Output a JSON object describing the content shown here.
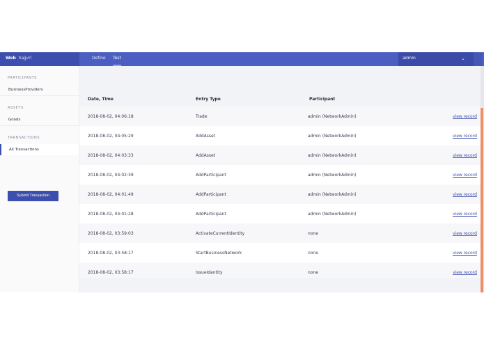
{
  "header": {
    "brand_strong": "Web",
    "brand_sub": "hajjvrl",
    "tabs": [
      {
        "label": "Define"
      },
      {
        "label": "Test"
      }
    ],
    "identity": "admin"
  },
  "sidebar": {
    "sections": [
      {
        "title": "PARTICIPANTS",
        "items": [
          "BusinessProviders"
        ]
      },
      {
        "title": "ASSETS",
        "items": [
          "Goods"
        ]
      },
      {
        "title": "TRANSACTIONS",
        "items": [
          "All Transactions"
        ]
      }
    ],
    "submit_label": "Submit Transaction"
  },
  "table": {
    "columns": [
      "Date, Time",
      "Entry Type",
      "Participant"
    ],
    "link_label": "view record",
    "rows": [
      {
        "date": "2018-08-02, 04:06:18",
        "type": "Trade",
        "participant": "admin (NetworkAdmin)"
      },
      {
        "date": "2018-08-02, 04:05:29",
        "type": "AddAsset",
        "participant": "admin (NetworkAdmin)"
      },
      {
        "date": "2018-08-02, 04:03:33",
        "type": "AddAsset",
        "participant": "admin (NetworkAdmin)"
      },
      {
        "date": "2018-08-02, 04:02:39",
        "type": "AddParticipant",
        "participant": "admin (NetworkAdmin)"
      },
      {
        "date": "2018-08-02, 04:01:49",
        "type": "AddParticipant",
        "participant": "admin (NetworkAdmin)"
      },
      {
        "date": "2018-08-02, 04:01:28",
        "type": "AddParticipant",
        "participant": "admin (NetworkAdmin)"
      },
      {
        "date": "2018-08-02, 03:59:03",
        "type": "ActivateCurrentIdentity",
        "participant": "none"
      },
      {
        "date": "2018-08-02, 03:58:17",
        "type": "StartBusinessNetwork",
        "participant": "none"
      },
      {
        "date": "2018-08-02, 03:58:17",
        "type": "IssueIdentity",
        "participant": "none"
      }
    ]
  },
  "colors": {
    "primary": "#4a5fc1",
    "primary_dark": "#3d4fae",
    "accent": "#ef8f68"
  },
  "icons": {
    "dropdown": "chevron-down-icon"
  }
}
